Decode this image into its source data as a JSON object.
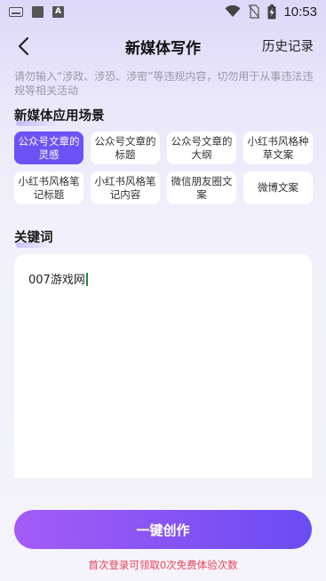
{
  "status_bar": {
    "time": "10:53",
    "icons": [
      "keyboard-icon",
      "square-icon",
      "a-badge-icon",
      "wifi-icon",
      "no-sim-icon",
      "battery-charging-icon"
    ]
  },
  "nav": {
    "title": "新媒体写作",
    "history_label": "历史记录",
    "back_icon": "chevron-left-icon"
  },
  "notice": "请勿输入“涉政、涉恐、涉密”等违规内容，切勿用于从事违法违规等相关活动",
  "scenes": {
    "title": "新媒体应用场景",
    "items": [
      {
        "label": "公众号文章的灵感",
        "active": true
      },
      {
        "label": "公众号文章的标题",
        "active": false
      },
      {
        "label": "公众号文章的大纲",
        "active": false
      },
      {
        "label": "小红书风格种草文案",
        "active": false
      },
      {
        "label": "小红书风格笔记标题",
        "active": false
      },
      {
        "label": "小红书风格笔记内容",
        "active": false
      },
      {
        "label": "微信朋友圈文案",
        "active": false
      },
      {
        "label": "微博文案",
        "active": false
      }
    ]
  },
  "keywords": {
    "title": "关键词",
    "value": "007游戏网"
  },
  "action": {
    "create_label": "一键创作",
    "promo": "首次登录可领取0次免费体验次数"
  },
  "colors": {
    "accent": "#6c52f5",
    "button_start": "#a45cf5",
    "button_end": "#6a4cf3",
    "promo": "#e8445a"
  }
}
